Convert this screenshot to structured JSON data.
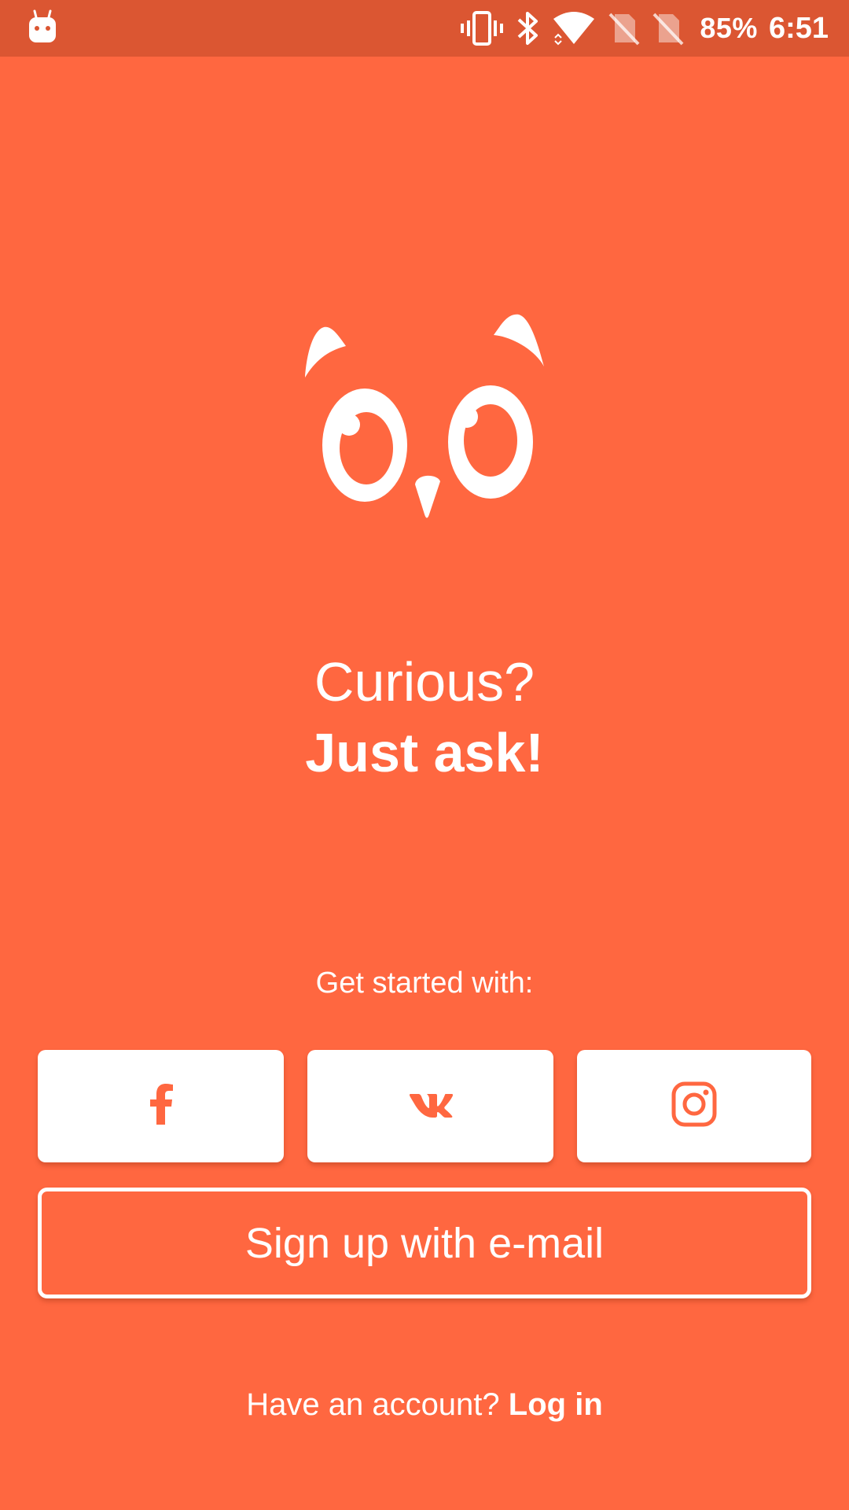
{
  "status_bar": {
    "battery": "85%",
    "time": "6:51",
    "icons": [
      "android-notification-icon",
      "vibrate-icon",
      "bluetooth-icon",
      "wifi-icon",
      "no-sim-icon",
      "no-sim-icon"
    ]
  },
  "logo": {
    "icon": "owl-face-icon"
  },
  "headline": {
    "line1": "Curious?",
    "line2": "Just ask!"
  },
  "get_started": {
    "label": "Get started with:"
  },
  "social_buttons": [
    {
      "icon": "facebook-icon"
    },
    {
      "icon": "vk-icon"
    },
    {
      "icon": "instagram-icon"
    }
  ],
  "email_button": {
    "label": "Sign up with e-mail"
  },
  "login": {
    "prompt": "Have an account?",
    "link": "Log in"
  },
  "colors": {
    "background": "#FF6740",
    "status_bar": "#DB5632",
    "button_bg": "#FFFFFF",
    "accent": "#FF6740"
  }
}
